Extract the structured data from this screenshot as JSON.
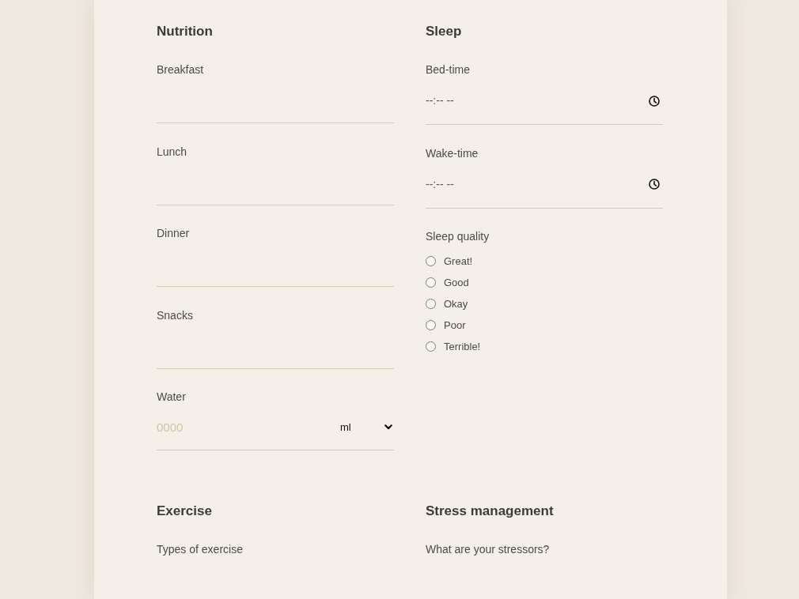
{
  "sections": [
    {
      "title": "Nutrition",
      "fields": [
        {
          "kind": "text",
          "label": "Breakfast"
        },
        {
          "kind": "text",
          "label": "Lunch"
        },
        {
          "kind": "text",
          "label": "Dinner"
        },
        {
          "kind": "text",
          "label": "Snacks"
        },
        {
          "kind": "quantity",
          "label": "Water",
          "placeholder": "0000",
          "unit": "ml"
        }
      ]
    },
    {
      "title": "Sleep",
      "fields": [
        {
          "kind": "time",
          "label": "Bed-time",
          "value": "--:-- --"
        },
        {
          "kind": "time",
          "label": "Wake-time",
          "value": "--:-- --"
        },
        {
          "kind": "radio",
          "label": "Sleep quality",
          "options": [
            {
              "label": "Great!",
              "selected": false
            },
            {
              "label": "Good",
              "selected": false
            },
            {
              "label": "Okay",
              "selected": false
            },
            {
              "label": "Poor",
              "selected": false
            },
            {
              "label": "Terrible!",
              "selected": false
            }
          ]
        }
      ]
    },
    {
      "title": "Exercise",
      "fields": [
        {
          "kind": "prompt",
          "label": "Types of exercise"
        }
      ]
    },
    {
      "title": "Stress management",
      "fields": [
        {
          "kind": "prompt",
          "label": "What are your stressors?"
        }
      ]
    }
  ]
}
